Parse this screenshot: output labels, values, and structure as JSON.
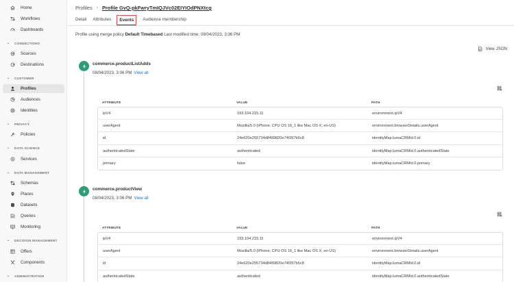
{
  "sidebar": {
    "items": [
      {
        "label": "Home",
        "icon": "home-icon"
      },
      {
        "label": "Workflows",
        "icon": "workflow-icon"
      },
      {
        "label": "Dashboards",
        "icon": "dashboard-icon"
      },
      {
        "label": "Sources",
        "icon": "sources-icon"
      },
      {
        "label": "Destinations",
        "icon": "destinations-icon"
      },
      {
        "label": "Profiles",
        "icon": "profile-icon"
      },
      {
        "label": "Audiences",
        "icon": "audiences-icon"
      },
      {
        "label": "Identities",
        "icon": "identities-icon"
      },
      {
        "label": "Policies",
        "icon": "policies-icon"
      },
      {
        "label": "Services",
        "icon": "services-icon"
      },
      {
        "label": "Schemas",
        "icon": "schemas-icon"
      },
      {
        "label": "Places",
        "icon": "places-icon"
      },
      {
        "label": "Datasets",
        "icon": "datasets-icon"
      },
      {
        "label": "Queries",
        "icon": "queries-icon"
      },
      {
        "label": "Monitoring",
        "icon": "monitoring-icon"
      },
      {
        "label": "Offers",
        "icon": "offers-icon"
      },
      {
        "label": "Components",
        "icon": "components-icon"
      }
    ],
    "sections": [
      "CONNECTIONS",
      "CUSTOMER",
      "PRIVACY",
      "DATA SCIENCE",
      "DATA MANAGEMENT",
      "DECISION MANAGEMENT",
      "ADMINISTRATION"
    ],
    "active_item": "Profiles"
  },
  "header": {
    "breadcrumb_parent": "Profiles",
    "breadcrumb_current": "Profile GvQ-pkFwryTmIQJVc02EIYIOdPNXtcg"
  },
  "tabs": [
    {
      "label": "Detail"
    },
    {
      "label": "Attributes"
    },
    {
      "label": "Events",
      "selected": true
    },
    {
      "label": "Audience membership"
    }
  ],
  "policy": {
    "prefix": "Profile using merge policy",
    "name": "Default Timebased",
    "suffix": "Last modified time: 08/04/2023, 3:36 PM"
  },
  "view_json_label": "View JSON",
  "events": [
    {
      "name": "commerce.productListAdds",
      "time": "08/04/2023, 3:06 PM",
      "view_all": "View all",
      "columns": [
        "ATTRIBUTE",
        "VALUE",
        "PATH"
      ],
      "rows": [
        [
          "ipV4",
          "193.104.215.11",
          "environment.ipV4"
        ],
        [
          "userAgent",
          "Mozilla/5.0 (iPhone; CPU OS 16_1 like Mac OS X; en-US)",
          "environment.browserDetails.userAgent"
        ],
        [
          "id",
          "24e620e255734d8489820e74f357b5c8",
          "identityMap.lumaCRMId.0.id"
        ],
        [
          "authenticatedState",
          "authenticated",
          "identityMap.lumaCRMId.0.authenticatedState"
        ],
        [
          "primary",
          "false",
          "identityMap.lumaCRMId.0.primary"
        ]
      ]
    },
    {
      "name": "commerce.productView",
      "time": "08/04/2023, 3:06 PM",
      "view_all": "View all",
      "columns": [
        "ATTRIBUTE",
        "VALUE",
        "PATH"
      ],
      "rows": [
        [
          "ipV4",
          "193.104.215.11",
          "environment.ipV4"
        ],
        [
          "userAgent",
          "Mozilla/5.0 (iPhone; CPU OS 16_1 like Mac OS X; en-US)",
          "environment.browserDetails.userAgent"
        ],
        [
          "id",
          "24e620e255734d8489820e74f357b5c8",
          "identityMap.lumaCRMId.0.id"
        ],
        [
          "authenticatedState",
          "authenticated",
          "identityMap.lumaCRMId.0.authenticatedState"
        ]
      ]
    }
  ],
  "colors": {
    "accent": "#1473e6",
    "event_icon": "#2d9d78",
    "tab_highlight": "#e34850"
  }
}
